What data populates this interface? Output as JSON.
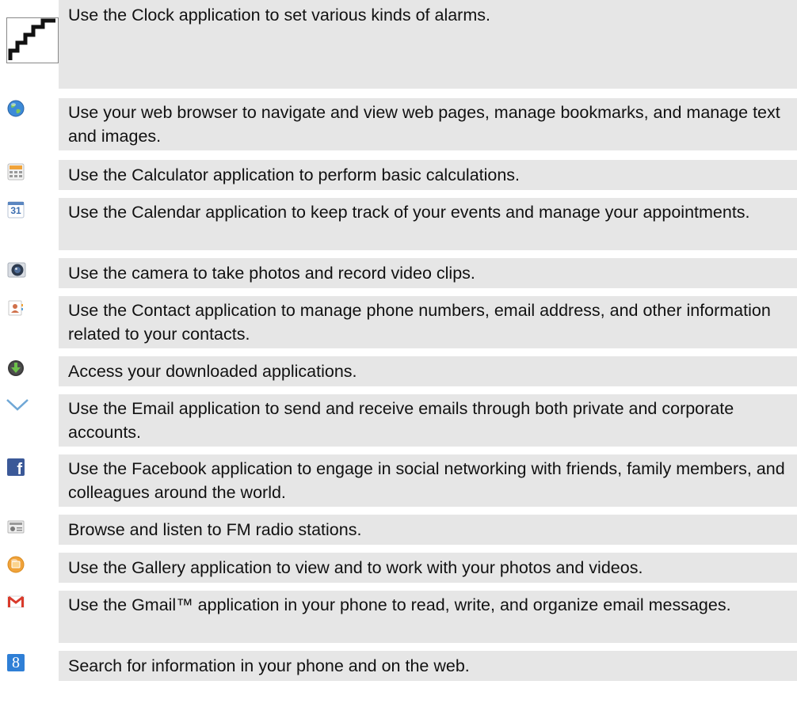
{
  "rows": [
    {
      "icon": "stairs-icon",
      "text": "Use the Clock application to set various kinds of alarms."
    },
    {
      "icon": "globe-icon",
      "text": "Use your web browser to navigate and view web pages, manage bookmarks, and manage text and images."
    },
    {
      "icon": "calculator-icon",
      "text": "Use the Calculator application to perform basic calculations."
    },
    {
      "icon": "calendar-icon",
      "icon_text": "31",
      "text": "Use the Calendar application to keep track of your events and manage your appointments."
    },
    {
      "icon": "camera-icon",
      "text": "Use the camera to take photos and record video clips."
    },
    {
      "icon": "contacts-icon",
      "text": "Use the Contact application to manage phone numbers, email address, and other information related to your contacts."
    },
    {
      "icon": "download-icon",
      "text": "Access your downloaded applications."
    },
    {
      "icon": "email-icon",
      "text": "Use the Email application to send and receive emails through both private and corporate accounts."
    },
    {
      "icon": "facebook-icon",
      "icon_text": "f",
      "text": "Use the Facebook application to engage in social networking with friends, family members, and colleagues around the world."
    },
    {
      "icon": "radio-icon",
      "text": "Browse and listen to FM radio stations."
    },
    {
      "icon": "gallery-icon",
      "text": "Use the Gallery application to view and to work with your photos and videos."
    },
    {
      "icon": "gmail-icon",
      "text": "Use the Gmail™ application in your phone to read, write, and organize email messages."
    },
    {
      "icon": "google-search-icon",
      "icon_text": "8",
      "text": "Search for information in your phone and on the web."
    }
  ],
  "colors": {
    "row_background": "#e6e6e6",
    "text": "#111111",
    "facebook_blue": "#3b5998",
    "google_blue": "#2f7fd6",
    "gmail_red": "#d93a2b",
    "gallery_orange": "#f0a33a",
    "download_green": "#3a3a3a",
    "email_blue": "#6fa7d6"
  }
}
